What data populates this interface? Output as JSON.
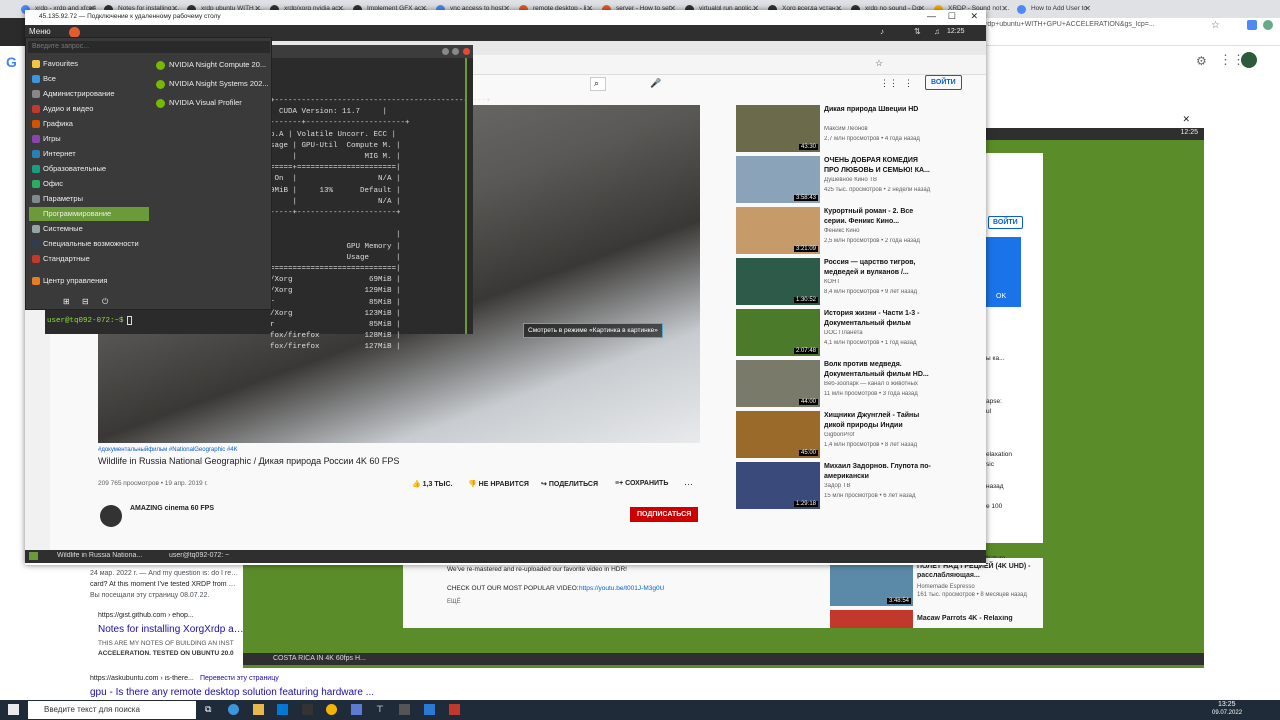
{
  "host_tabs": [
    "xrdp - xrdp and xfce4",
    "Notes for installing XorgXrdp",
    "xrdp ubuntu WITH GPU",
    "xrdp/xorg nvidia acceleration",
    "Implement GFX acceleration",
    "vnc access to host",
    "remote desktop - linux",
    "server - How to set",
    "virtualgl run application",
    "Xorg всегда установка",
    "xrdp no sound - Do",
    "XRDP - Sound not working",
    "How to Add User to"
  ],
  "host_url_fragment": "rdp+ubuntu+WITH+GPU+ACCELERATION&gs_lcp=...",
  "rdp": {
    "title": "45.135.92.72 — Подключение к удаленному рабочему столу",
    "clock": "12:25",
    "clock2": "12:25"
  },
  "menu": {
    "button": "Меню",
    "search_placeholder": "Введите запрос...",
    "categories": [
      "Favourites",
      "Все",
      "Администрирование",
      "Аудио и видео",
      "Графика",
      "Игры",
      "Интернет",
      "Образовательные",
      "Офис",
      "Параметры",
      "Программирование",
      "Системные",
      "Специальные возможности",
      "Стандартные",
      "Центр управления"
    ],
    "selected": "Программирование",
    "apps": [
      "NVIDIA Nsight Compute 20...",
      "NVIDIA Nsight Systems 202...",
      "NVIDIA Visual Profiler"
    ]
  },
  "terminal": {
    "lines": [
      "+-----------------------------------------------+",
      "  CUDA Version: 11.7     |",
      "-------+----------------------+",
      "p.A | Volatile Uncorr. ECC |",
      "sage | GPU-Util  Compute M. |",
      "     |               MIG M. |",
      "=====+======================|",
      " On  |                  N/A |",
      "9MiB |     13%      Default |",
      "     |                  N/A |",
      "-----+----------------------+",
      "",
      "                            |",
      "                 GPU Memory |",
      "                 Usage      |",
      "============================|",
      "/Xorg                 69MiB |",
      "/Xorg                129MiB |",
      "r                     85MiB |",
      "/Xorg                123MiB |",
      "r                     85MiB |",
      "fox/firefox          128MiB |",
      "fox/firefox          127MiB |"
    ],
    "prompt": "user@tq092-072:~$"
  },
  "youtube": {
    "sign_in": "ВОЙТИ",
    "pip_label": "Смотреть в режиме «Картинка в картинке»",
    "hashtags": "#документальныйфильм #NationalGeographic #4K",
    "title": "Wildlife in Russia National Geographic / Дикая природа России 4K 60 FPS",
    "views": "209 765 просмотров • 19 апр. 2019 г.",
    "likes": "1,3 ТЫС.",
    "dislike": "НЕ НРАВИТСЯ",
    "share": "ПОДЕЛИТЬСЯ",
    "save": "СОХРАНИТЬ",
    "channel": "AMAZING cinema 60 FPS",
    "subscribe": "ПОДПИСАТЬСЯ",
    "sidebar": [
      {
        "title": "Дикая природа Швеции HD",
        "channel": "Максим Леонов",
        "meta": "2,7 млн просмотров • 4 года назад",
        "duration": "43:30",
        "color": "#6b6a4a"
      },
      {
        "title": "ОЧЕНЬ ДОБРАЯ КОМЕДИЯ ПРО ЛЮБОВЬ И СЕМЬЮ! КА...",
        "channel": "Душевное Кино ТВ",
        "meta": "425 тыс. просмотров • 2 недели назад",
        "duration": "3:58:43",
        "color": "#8aa3b8"
      },
      {
        "title": "Курортный роман - 2. Все серии. Феникс Кино...",
        "channel": "Феникс Кино",
        "meta": "2,5 млн просмотров • 2 года назад",
        "duration": "3:21:09",
        "color": "#c79a6a"
      },
      {
        "title": "Россия — царство тигров, медведей и вулканов /...",
        "channel": "КОНТ",
        "meta": "8,4 млн просмотров • 9 лет назад",
        "duration": "1:30:52",
        "color": "#2e5a4a"
      },
      {
        "title": "История жизни - Части 1-3 - Документальный фильм",
        "channel": "DOC Планета",
        "meta": "4,1 млн просмотров • 1 год назад",
        "duration": "2:07:48",
        "color": "#4a7a2a"
      },
      {
        "title": "Волк против медведя. Документальный фильм HD...",
        "channel": "Веб-зоопарк — канал о животных",
        "meta": "11 млн просмотров • 3 года назад",
        "duration": "44:00",
        "color": "#7a7a6a"
      },
      {
        "title": "Хищники Джунглей - Тайны дикой природы Индии",
        "channel": "GigbonProf",
        "meta": "1,4 млн просмотров • 8 лет назад",
        "duration": "45:00",
        "color": "#9a6a2a"
      },
      {
        "title": "Михаил Задорнов. Глупота по-американски",
        "channel": "Задор ТВ",
        "meta": "15 млн просмотров • 6 лет назад",
        "duration": "1:29:18",
        "color": "#3a4a7a"
      }
    ]
  },
  "rdp2": {
    "desc1": "We've re-mastered and re-uploaded our favorite video in HDR!",
    "desc2": "CHECK OUT OUR MOST POPULAR VIDEO:",
    "desc_link": "https://youtu.be/t001J-M3g0U",
    "more": "ЕЩЁ",
    "side1_title": "ПОЛЁТ НАД ГРЕЦИЕЙ (4K UHD) - расслабляющая...",
    "side1_channel": "Homemade Espresso",
    "side1_meta": "161 тыс. просмотров • 8 месяцев назад",
    "side1_duration": "3:48:54",
    "side2_title": "Macaw Parrots 4K - Relaxing",
    "dialog_ok": "OK",
    "taskbar_item": "COSTA RICA IN 4K 60fps H...",
    "sign_in": "ВОЙТИ",
    "right_snips": [
      "apse:",
      "ul",
      "elaxation",
      "sic",
      "назад",
      "e 100",
      "Nature",
      "usic for...",
      "назад",
      "ы ка..."
    ]
  },
  "bottompanel": {
    "task1": "Wildlife in Russia Nationa...",
    "task2": "user@tq092-072: ~"
  },
  "google": {
    "r1_date": "24 мар. 2022 г. — And my question is: do I really",
    "r1_line2": "card? At this moment I've tested XRDP from Ubu",
    "r1_visited": "Вы посещали эту страницу 08.07.22.",
    "r2_url": "https://gist.github.com › ehop...",
    "r2_title": "Notes for installing XorgXrdp and",
    "r2_snip1": "THIS ARE MY NOTES OF BUILDING AN INST",
    "r2_snip2": "ACCELERATION. TESTED ON UBUNTU 20.0",
    "r3_url": "https://askubuntu.com › is-there...",
    "r3_translate": "Перевести эту страницу",
    "r3_title": "gpu - Is there any remote desktop solution featuring hardware ..."
  },
  "taskbar": {
    "search": "Введите текст для поиска",
    "time": "13:25",
    "date": "09.07.2022"
  }
}
